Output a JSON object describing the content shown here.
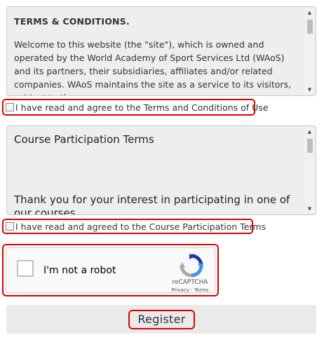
{
  "terms_box": {
    "title": "TERMS & CONDITIONS.",
    "body": "Welcome to this website (the \"site\"), which is owned and operated by the World Academy of Sport Services Ltd (WAoS) and its partners, their subsidiaries, affiliates and/or related companies. WAoS maintains the site as a service to its visitors, subject to the"
  },
  "terms_agree": {
    "label": "I have read and agree to the Terms and Conditions of Use"
  },
  "course_box": {
    "title": "Course Participation Terms",
    "body": "Thank you for your interest in participating in one of our courses."
  },
  "course_agree": {
    "label": "I have read and agreed to the Course Participation Terms"
  },
  "captcha": {
    "label": "I'm not a robot",
    "brand": "reCAPTCHA",
    "links": "Privacy - Terms"
  },
  "register": {
    "label": "Register"
  },
  "icons": {
    "scroll_up": "arrow-up-icon",
    "scroll_down": "arrow-down-icon",
    "recaptcha": "recaptcha-logo-icon"
  },
  "colors": {
    "highlight": "#e00000",
    "panel": "#eeeeee"
  }
}
